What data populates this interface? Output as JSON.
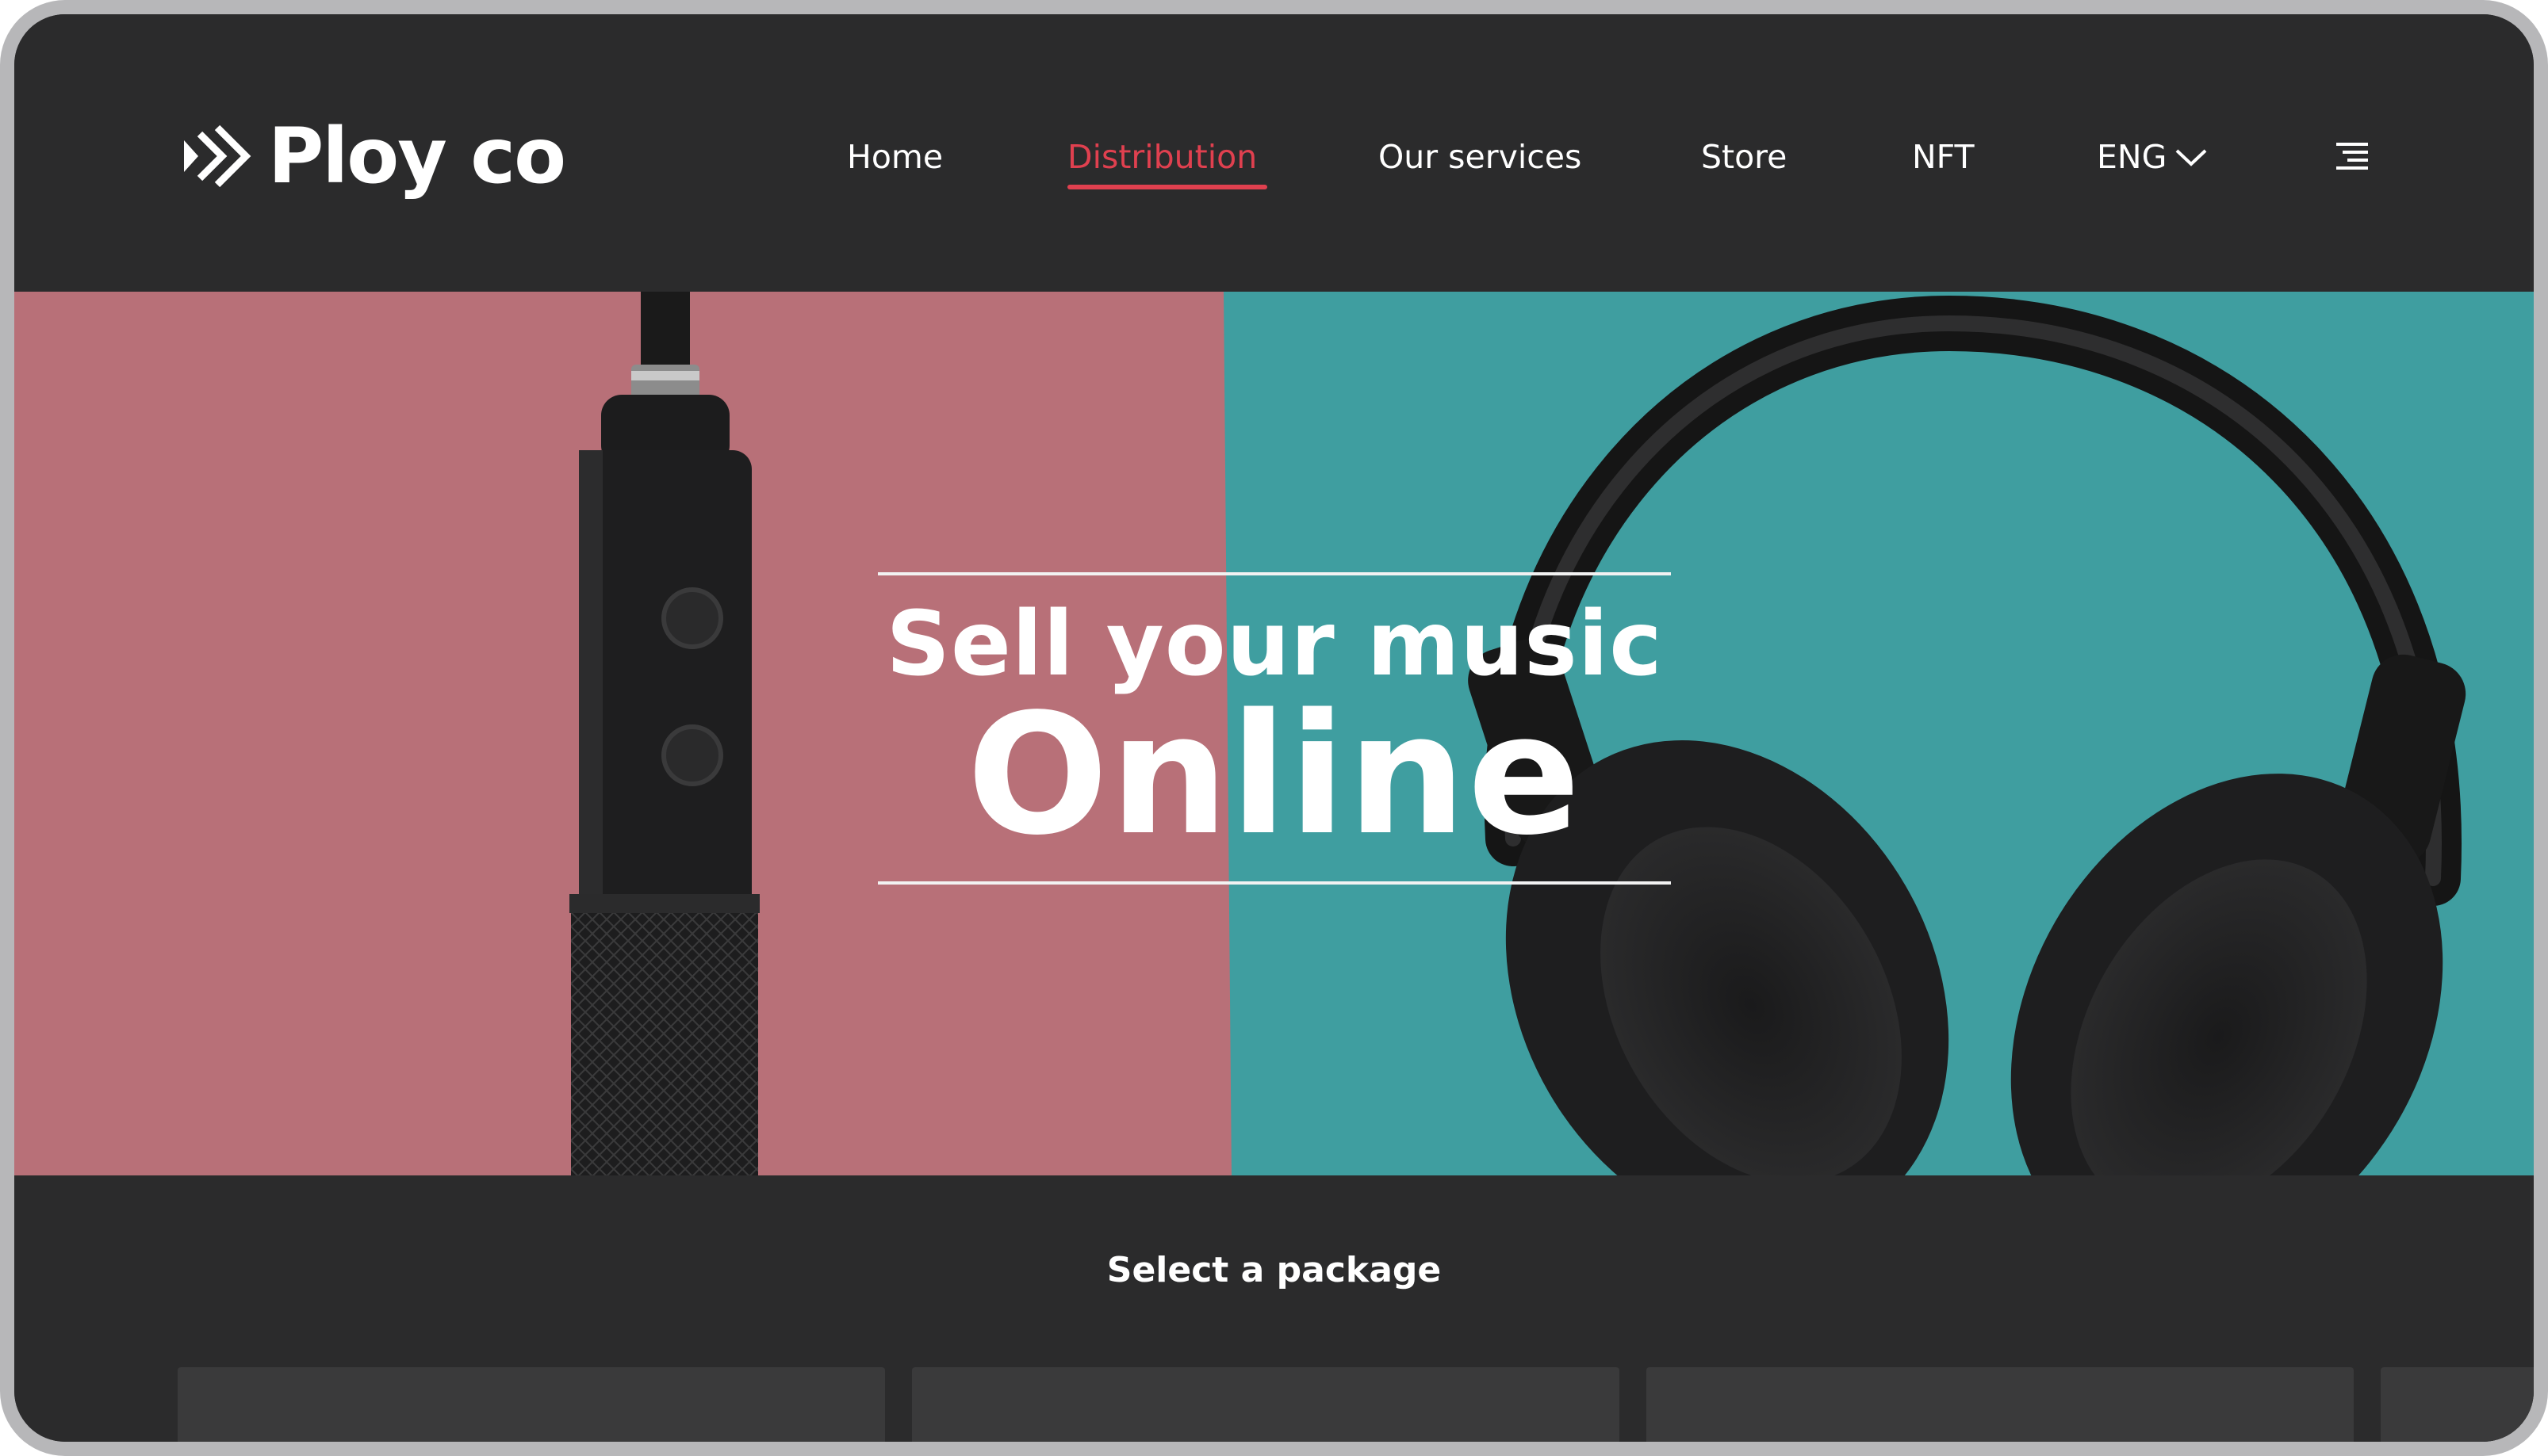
{
  "brand": {
    "name": "Ploy co",
    "logo_icon": "triple-chevron-play-icon"
  },
  "nav": {
    "items": [
      {
        "label": "Home",
        "active": false
      },
      {
        "label": "Distribution",
        "active": true
      },
      {
        "label": "Our services",
        "active": false
      },
      {
        "label": "Store",
        "active": false
      },
      {
        "label": "NFT",
        "active": false
      }
    ],
    "language": {
      "label": "ENG",
      "icon": "chevron-down-icon"
    },
    "menu_icon": "hamburger-menu-icon"
  },
  "hero": {
    "subtitle": "Sell your music",
    "title": "Online"
  },
  "packages": {
    "heading": "Select a package",
    "cards": [
      {},
      {},
      {},
      {}
    ]
  },
  "colors": {
    "background": "#2b2b2c",
    "accent": "#e0404f",
    "hero_left": "#b87078",
    "hero_right": "#3f9ea0",
    "card": "#3a3a3b"
  }
}
